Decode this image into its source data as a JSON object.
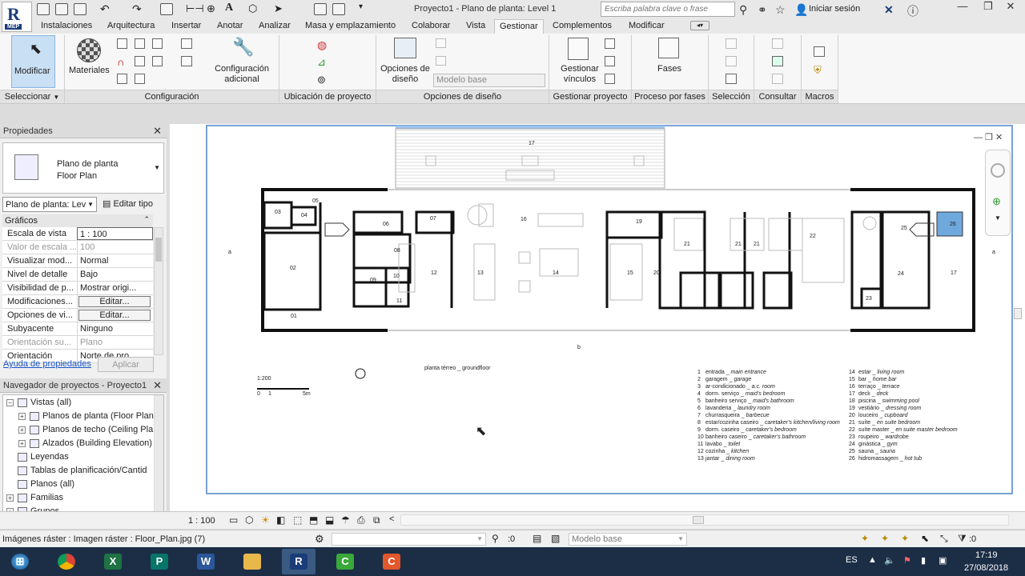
{
  "app": {
    "title": "Proyecto1 - Plano de planta: Level 1",
    "logo_text": "R",
    "logo_badge": "MEP",
    "search_placeholder": "Escriba palabra clave o frase",
    "login_label": "Iniciar sesión"
  },
  "tabs": [
    "Instalaciones",
    "Arquitectura",
    "Insertar",
    "Anotar",
    "Analizar",
    "Masa y emplazamiento",
    "Colaborar",
    "Vista",
    "Gestionar",
    "Complementos",
    "Modificar"
  ],
  "active_tab": "Gestionar",
  "ribbon": {
    "modify_label": "Modificar",
    "materials_label": "Materiales",
    "extra_config_label": "Configuración adicional",
    "design_options_label": "Opciones de diseño",
    "design_dropdown_value": "Modelo base",
    "manage_links_label": "Gestionar vínculos",
    "phases_label": "Fases",
    "panels": {
      "select": "Seleccionar",
      "config": "Configuración",
      "location": "Ubicación de proyecto",
      "design_options": "Opciones de diseño",
      "manage_project": "Gestionar proyecto",
      "phasing": "Proceso por fases",
      "selection": "Selección",
      "inquiry": "Consultar",
      "macros": "Macros"
    }
  },
  "properties": {
    "header": "Propiedades",
    "type_line1": "Plano de planta",
    "type_line2": "Floor Plan",
    "instance_select": "Plano de planta: Lev",
    "edit_type": "Editar tipo",
    "group": "Gráficos",
    "rows": [
      {
        "k": "Escala de vista",
        "v": "1 : 100",
        "state": "input"
      },
      {
        "k": "Valor de escala ...",
        "v": "100",
        "state": "gray"
      },
      {
        "k": "Visualizar mod...",
        "v": "Normal",
        "state": "normal"
      },
      {
        "k": "Nivel de detalle",
        "v": "Bajo",
        "state": "normal"
      },
      {
        "k": "Visibilidad de p...",
        "v": "Mostrar origi...",
        "state": "normal"
      },
      {
        "k": "Modificaciones...",
        "v": "Editar...",
        "state": "button"
      },
      {
        "k": "Opciones de vi...",
        "v": "Editar...",
        "state": "button"
      },
      {
        "k": "Subyacente",
        "v": "Ninguno",
        "state": "normal"
      },
      {
        "k": "Orientación su...",
        "v": "Plano",
        "state": "gray"
      },
      {
        "k": "Orientación",
        "v": "Norte de pro...",
        "state": "normal"
      }
    ],
    "help_link": "Ayuda de propiedades",
    "apply": "Aplicar"
  },
  "navigator": {
    "header": "Navegador de proyectos - Proyecto1",
    "items": [
      {
        "label": "Vistas (all)",
        "level": 0,
        "pm": "−"
      },
      {
        "label": "Planos de planta (Floor Plan)",
        "level": 1,
        "pm": "+"
      },
      {
        "label": "Planos de techo (Ceiling Plan",
        "level": 1,
        "pm": "+"
      },
      {
        "label": "Alzados (Building Elevation)",
        "level": 1,
        "pm": "+"
      },
      {
        "label": "Leyendas",
        "level": 0,
        "pm": ""
      },
      {
        "label": "Tablas de planificación/Cantid",
        "level": 0,
        "pm": ""
      },
      {
        "label": "Planos (all)",
        "level": 0,
        "pm": ""
      },
      {
        "label": "Familias",
        "level": 0,
        "pm": "+"
      },
      {
        "label": "Grupos",
        "level": 0,
        "pm": "+"
      }
    ]
  },
  "drawing": {
    "rooms": [
      "17",
      "05",
      "03",
      "04",
      "06",
      "07",
      "16",
      "19",
      "25",
      "26",
      "02",
      "08",
      "12",
      "13",
      "14",
      "15",
      "20",
      "21",
      "21",
      "21",
      "22",
      "24",
      "17",
      "09",
      "10",
      "11",
      "23",
      "01"
    ],
    "plan_title": "planta térreo _ groundfloor",
    "plan_scale": "1:200",
    "scale_marks": [
      "0",
      "1",
      "5m"
    ],
    "section_marks": [
      "a",
      "a",
      "b"
    ],
    "legend_left": [
      {
        "n": "1",
        "pt": "entrada",
        "en": "main entrance"
      },
      {
        "n": "2",
        "pt": "garagem",
        "en": "garage"
      },
      {
        "n": "3",
        "pt": "ar-condicionado",
        "en": "a.c. room"
      },
      {
        "n": "4",
        "pt": "dorm. serviço",
        "en": "maid's bedroom"
      },
      {
        "n": "5",
        "pt": "banheiro serviço",
        "en": "maid's bathroom"
      },
      {
        "n": "6",
        "pt": "lavanderia",
        "en": "laundry room"
      },
      {
        "n": "7",
        "pt": "churrasqueira",
        "en": "barbecue"
      },
      {
        "n": "8",
        "pt": "estar/cozinha caseiro",
        "en": "caretaker's kitchen/living room"
      },
      {
        "n": "9",
        "pt": "dorm. caseiro",
        "en": "caretaker's bedroom"
      },
      {
        "n": "10",
        "pt": "banheiro caseiro",
        "en": "caretaker's bathroom"
      },
      {
        "n": "11",
        "pt": "lavabo",
        "en": "toilet"
      },
      {
        "n": "12",
        "pt": "cozinha",
        "en": "kitchen"
      },
      {
        "n": "13",
        "pt": "jantar",
        "en": "dining room"
      }
    ],
    "legend_right": [
      {
        "n": "14",
        "pt": "estar",
        "en": "living room"
      },
      {
        "n": "15",
        "pt": "bar",
        "en": "home bar"
      },
      {
        "n": "16",
        "pt": "terraço",
        "en": "terrace"
      },
      {
        "n": "17",
        "pt": "deck",
        "en": "deck"
      },
      {
        "n": "18",
        "pt": "piscina",
        "en": "swimming pool"
      },
      {
        "n": "19",
        "pt": "vestiário",
        "en": "dressing room"
      },
      {
        "n": "20",
        "pt": "louceiro",
        "en": "cupboard"
      },
      {
        "n": "21",
        "pt": "suíte",
        "en": "en suite bedroom"
      },
      {
        "n": "22",
        "pt": "suíte master",
        "en": "en suite master bedroom"
      },
      {
        "n": "23",
        "pt": "roupeiro",
        "en": "wardrobe"
      },
      {
        "n": "24",
        "pt": "ginástica",
        "en": "gym"
      },
      {
        "n": "25",
        "pt": "sauna",
        "en": "sauna"
      },
      {
        "n": "26",
        "pt": "hidromassagem",
        "en": "hot tub"
      }
    ]
  },
  "viewbar": {
    "scale": "1 : 100"
  },
  "statusbar": {
    "text": "Imágenes ráster : Imagen ráster : Floor_Plan.jpg (7)",
    "count_a": ":0",
    "model": "Modelo base",
    "count_b": ":0"
  },
  "taskbar": {
    "lang": "ES",
    "time": "17:19",
    "date": "27/08/2018"
  },
  "colors": {
    "accent": "#1a3c78",
    "ribbon_selected": "#c9dff4",
    "hottub": "#6fa8dc",
    "taskbar": "#1c2e46"
  }
}
